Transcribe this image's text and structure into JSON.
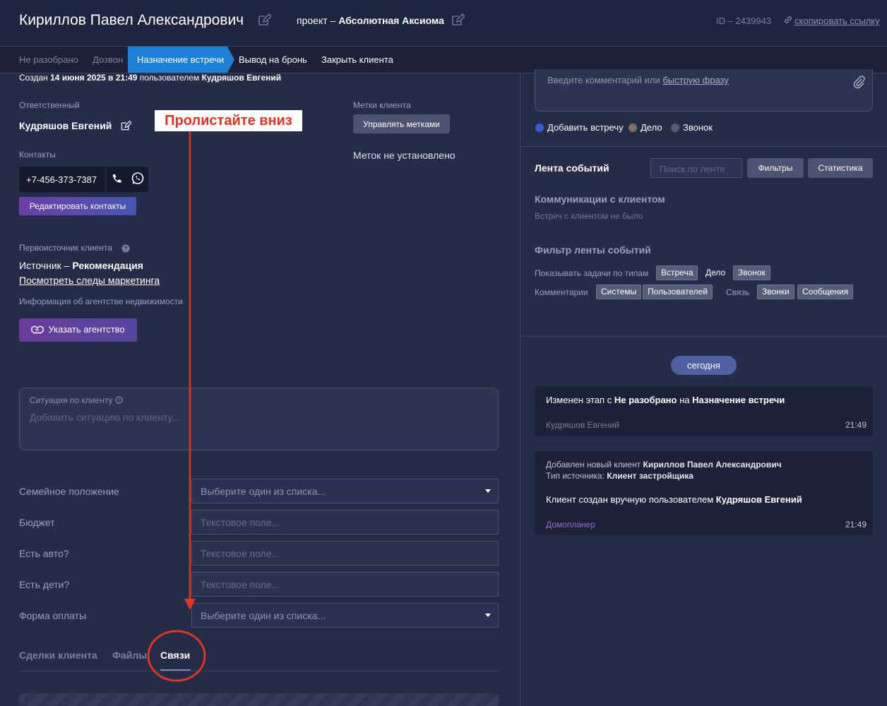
{
  "header": {
    "client_name": "Кириллов Павел Александрович",
    "project_prefix": "проект –",
    "project_name": "Абсолютная Аксиома",
    "client_id": "ID – 2439943",
    "copy_link": "скопировать ссылку"
  },
  "stages": [
    {
      "label": "Не разобрано",
      "state": "done"
    },
    {
      "label": "Дозвон",
      "state": "done"
    },
    {
      "label": "Назначение встречи",
      "state": "active"
    },
    {
      "label": "Вывод на бронь",
      "state": "future"
    },
    {
      "label": "Закрыть клиента",
      "state": "future"
    }
  ],
  "left": {
    "created_prefix": "Создан",
    "created_date": "14 июня 2025 в 21:49",
    "created_by_prefix": "пользователем",
    "created_by": "Кудряшов Евгений",
    "responsible_label": "Ответственный",
    "responsible_name": "Кудряшов Евгений",
    "contacts_label": "Контакты",
    "phone": "+7-456-373-7387",
    "edit_contacts": "Редактировать контакты",
    "source_label": "Первоисточник клиента",
    "source_prefix": "Источник –",
    "source_value": "Рекомендация",
    "marketing_link": "Посмотреть следы маркетинга",
    "agency_label": "Информация об агентстве недвижимости",
    "agency_button": "Указать агентство",
    "tags_label": "Метки клиента",
    "tags_button": "Управлять метками",
    "no_tags": "Меток не установлено",
    "situation_label": "Ситуация по клиенту",
    "situation_placeholder": "Добавить ситуацию по клиенту...",
    "fields": [
      {
        "label": "Семейное положение",
        "placeholder": "Выберите один из списка...",
        "type": "select"
      },
      {
        "label": "Бюджет",
        "placeholder": "Текстовое поле...",
        "type": "text"
      },
      {
        "label": "Есть авто?",
        "placeholder": "Текстовое поле...",
        "type": "text"
      },
      {
        "label": "Есть дети?",
        "placeholder": "Текстовое поле...",
        "type": "text"
      },
      {
        "label": "Форма оплаты",
        "placeholder": "Выберите один из списка...",
        "type": "select"
      }
    ],
    "tabs": [
      "Сделки клиента",
      "Файлы",
      "Связи"
    ],
    "active_tab": "Связи"
  },
  "right": {
    "comment_placeholder": "Введите комментарий или",
    "comment_link": "быструю фразу",
    "options": [
      {
        "label": "Добавить встречу",
        "color": "#3b5bd6"
      },
      {
        "label": "Дело",
        "color": "#7d7258"
      },
      {
        "label": "Звонок",
        "color": "#555c76"
      }
    ],
    "feed_title": "Лента событий",
    "feed_search_placeholder": "Поиск по ленте",
    "filters_button": "Фильтры",
    "stats_button": "Статистика",
    "comm_title": "Коммуникации с клиентом",
    "comm_sub": "Встреч с клиентом не было",
    "filter_title": "Фильтр ленты событий",
    "task_types_label": "Показывать задачи по типам",
    "task_types": [
      "Встреча",
      "Дело",
      "Звонок"
    ],
    "comments_label": "Комментарии",
    "comments_types": [
      "Системы",
      "Пользователей"
    ],
    "link_label": "Связь",
    "link_types": [
      "Звонки",
      "Сообщения"
    ],
    "today": "сегодня",
    "event1": {
      "p1": "Изменен этап с",
      "from": "Не разобрано",
      "p2": "на",
      "to": "Назначение встречи",
      "author": "Кудряшов Евгений",
      "time": "21:49"
    },
    "event2": {
      "line1_prefix": "Добавлен новый клиент",
      "line1_name": "Кириллов Павел Александрович",
      "line2_prefix": "Тип источника:",
      "line2_value": "Клиент застройщика",
      "main_prefix": "Клиент создан вручную пользователем",
      "main_name": "Кудряшов Евгений",
      "author": "Домопланер",
      "time": "21:49"
    }
  },
  "annotation": {
    "hint": "Пролистайте вниз",
    "color": "#e53321"
  }
}
